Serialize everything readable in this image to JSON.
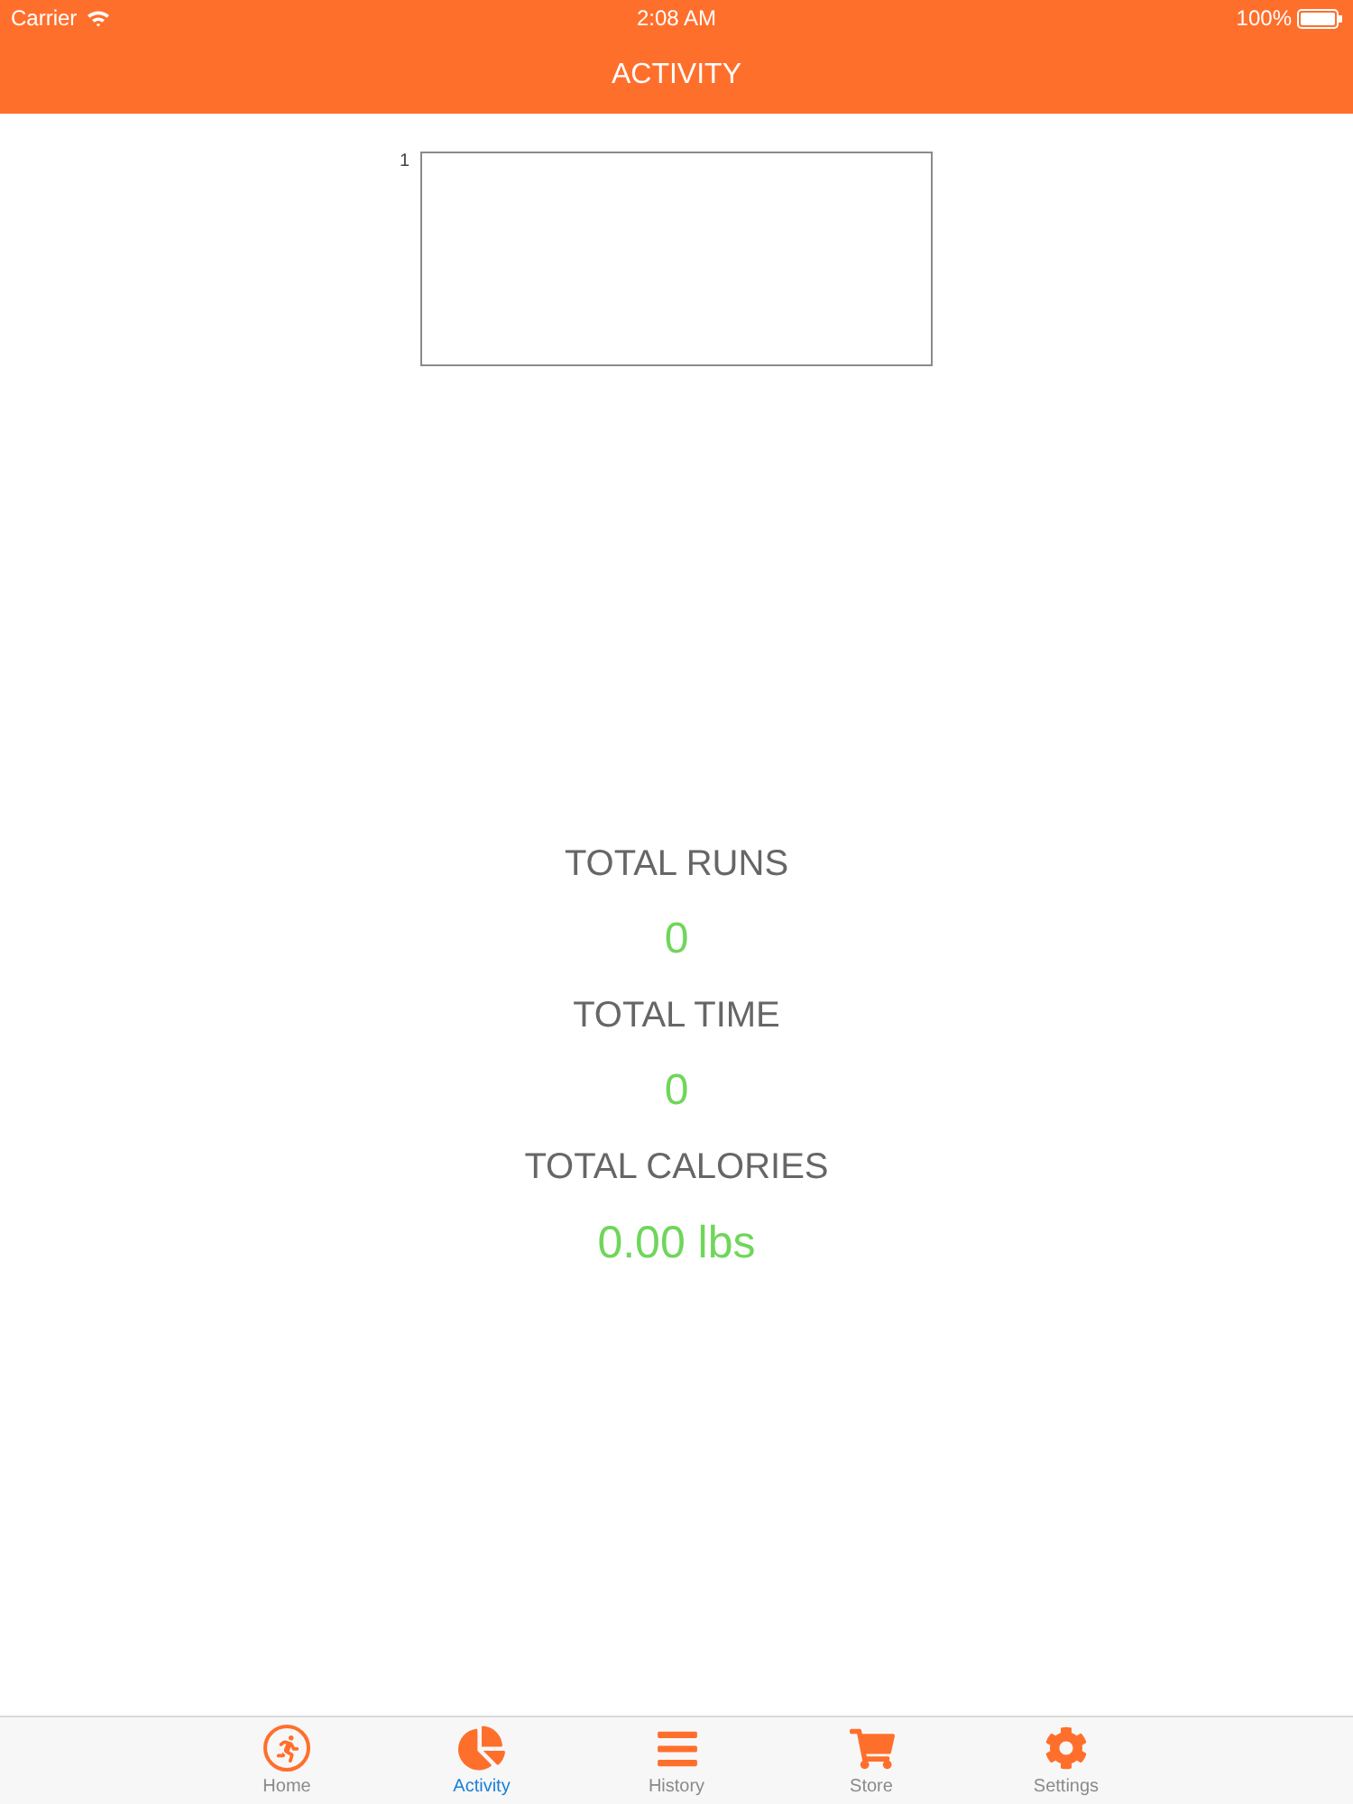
{
  "status_bar": {
    "carrier": "Carrier",
    "time": "2:08 AM",
    "battery": "100%"
  },
  "nav_bar": {
    "title": "ACTIVITY"
  },
  "chart": {
    "tick_label": "1"
  },
  "stats": [
    {
      "label": "TOTAL RUNS",
      "value": "0"
    },
    {
      "label": "TOTAL TIME",
      "value": "0"
    },
    {
      "label": "TOTAL CALORIES",
      "value": "0.00 lbs"
    }
  ],
  "tab_bar": {
    "items": [
      {
        "kind": "home",
        "label": "Home",
        "selected": false
      },
      {
        "kind": "activity",
        "label": "Activity",
        "selected": true
      },
      {
        "kind": "history",
        "label": "History",
        "selected": false
      },
      {
        "kind": "store",
        "label": "Store",
        "selected": false
      },
      {
        "kind": "settings",
        "label": "Settings",
        "selected": false
      }
    ]
  }
}
